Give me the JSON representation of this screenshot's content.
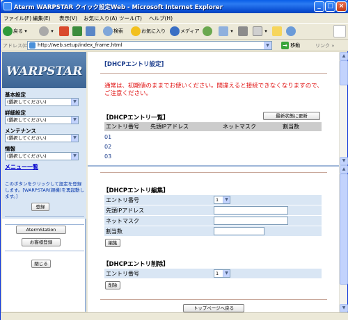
{
  "window": {
    "title": "Aterm WARPSTAR クイック設定Web - Microsoft Internet Explorer"
  },
  "menubar": {
    "items": [
      "ファイル(F)",
      "編集(E)",
      "表示(V)",
      "お気に入り(A)",
      "ツール(T)",
      "ヘルプ(H)"
    ]
  },
  "toolbar": {
    "back_label": "戻る",
    "search_label": "検索",
    "favorites_label": "お気に入り",
    "media_label": "メディア"
  },
  "address": {
    "label": "アドレス(D)",
    "url": "http://web.setup/index_frame.html",
    "go_label": "移動",
    "links_label": "リンク"
  },
  "sidebar": {
    "logo_text": "WARPSTAR",
    "groups": [
      {
        "label": "基本設定",
        "select_value": "(選択してください)"
      },
      {
        "label": "詳細設定",
        "select_value": "(選択してください)"
      },
      {
        "label": "メンテナンス",
        "select_value": "(選択してください)"
      },
      {
        "label": "情報",
        "select_value": "(選択してください)"
      }
    ],
    "menu_list_label": "メニュー一覧",
    "note": "このボタンをクリックして設定を登録します。[WARPSTAR(親機)を再起動します。]",
    "register_label": "登録",
    "aterm_station_label": "AtermStation",
    "customer_register_label": "お客様登録",
    "close_label": "閉じる"
  },
  "main": {
    "page_title": "[DHCPエントリ設定]",
    "warning": "通常は、初期値のままでお使いください。間違えると接続できなくなりますので、ご注意ください。",
    "list_section": "【DHCPエントリ一覧】",
    "refresh_label": "最新状態に更新",
    "columns": [
      "エントリ番号",
      "先頭IPアドレス",
      "ネットマスク",
      "割当数"
    ],
    "rows": [
      "01",
      "02",
      "03"
    ]
  },
  "edit": {
    "section": "【DHCPエントリ編集】",
    "fields": {
      "entry_number_label": "エントリ番号",
      "entry_number_value": "1",
      "start_ip_label": "先頭IPアドレス",
      "netmask_label": "ネットマスク",
      "count_label": "割当数"
    },
    "edit_button": "編集",
    "delete_section": "【DHCPエントリ削除】",
    "delete_entry_label": "エントリ番号",
    "delete_entry_value": "1",
    "delete_button": "削除",
    "top_page_button": "トップページへ戻る"
  }
}
